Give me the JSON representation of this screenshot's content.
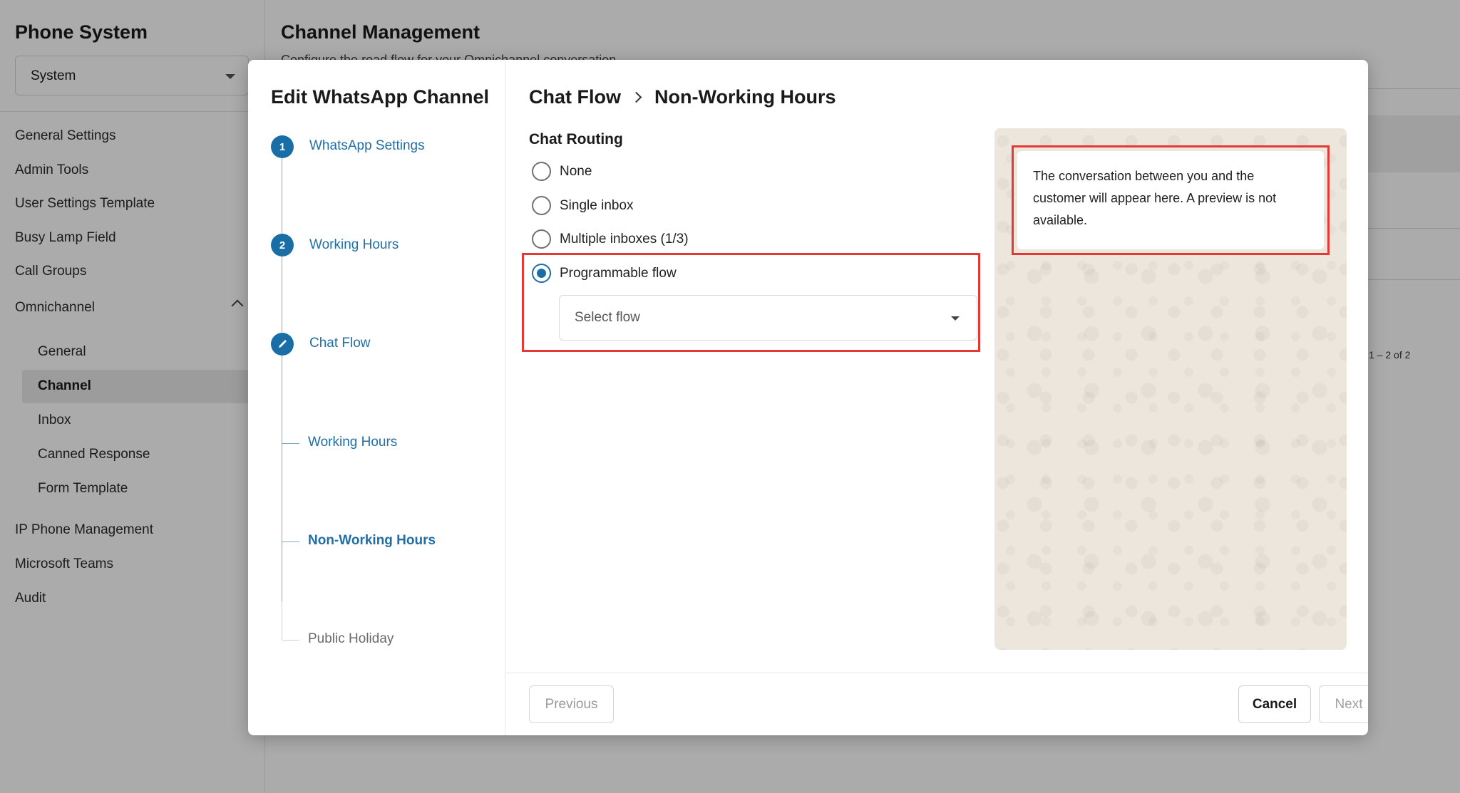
{
  "sidebar": {
    "title": "Phone System",
    "select_value": "System",
    "items": [
      {
        "label": "General Settings"
      },
      {
        "label": "Admin Tools"
      },
      {
        "label": "User Settings Template"
      },
      {
        "label": "Busy Lamp Field"
      },
      {
        "label": "Call Groups"
      },
      {
        "label": "Omnichannel"
      },
      {
        "label": "IP Phone Management"
      },
      {
        "label": "Microsoft Teams"
      },
      {
        "label": "Audit"
      }
    ],
    "omnichannel_sub": [
      {
        "label": "General"
      },
      {
        "label": "Channel"
      },
      {
        "label": "Inbox"
      },
      {
        "label": "Canned Response"
      },
      {
        "label": "Form Template"
      }
    ]
  },
  "main": {
    "title": "Channel Management",
    "subtitle": "Configure the road flow for your Omnichannel conversation",
    "pagination": "1 – 2 of 2"
  },
  "modal": {
    "title": "Edit WhatsApp Channel",
    "steps": [
      {
        "number": "1",
        "label": "WhatsApp Settings"
      },
      {
        "number": "2",
        "label": "Working Hours"
      },
      {
        "number": "",
        "label": "Chat Flow"
      }
    ],
    "substeps": [
      {
        "label": "Working Hours"
      },
      {
        "label": "Non-Working Hours"
      },
      {
        "label": "Public Holiday"
      }
    ],
    "breadcrumb": {
      "parent": "Chat Flow",
      "current": "Non-Working Hours"
    },
    "routing": {
      "title": "Chat Routing",
      "options": [
        {
          "label": "None",
          "checked": false
        },
        {
          "label": "Single inbox",
          "checked": false
        },
        {
          "label": "Multiple inboxes (1/3)",
          "checked": false
        },
        {
          "label": "Programmable flow",
          "checked": true
        }
      ],
      "flow_select_placeholder": "Select flow"
    },
    "preview_text": "The conversation between you and the customer will appear here. A preview is not available.",
    "footer": {
      "previous": "Previous",
      "cancel": "Cancel",
      "next": "Next"
    }
  },
  "colors": {
    "accent": "#1a6ea6",
    "highlight": "#e53935",
    "preview_bg": "#ede6dc"
  }
}
